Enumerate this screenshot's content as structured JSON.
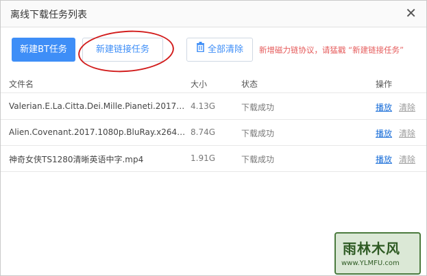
{
  "dialog": {
    "title": "离线下载任务列表",
    "close_glyph": "✕"
  },
  "toolbar": {
    "new_bt_label": "新建BT任务",
    "new_link_label": "新建链接任务",
    "clear_all_label": "全部清除",
    "hint_text": "新增磁力链协议，请猛戳 “新建链接任务”"
  },
  "table": {
    "headers": {
      "name": "文件名",
      "size": "大小",
      "status": "状态",
      "actions": "操作"
    },
    "rows": [
      {
        "name": "Valerian.E.La.Citta.Dei.Mille.Pianeti.2017.iTA...",
        "size": "4.13G",
        "status": "下载成功",
        "play": "播放",
        "clear": "清除"
      },
      {
        "name": "Alien.Covenant.2017.1080p.BluRay.x264-SP...",
        "size": "8.74G",
        "status": "下载成功",
        "play": "播放",
        "clear": "清除"
      },
      {
        "name": "神奇女侠TS1280清晰英语中字.mp4",
        "size": "1.91G",
        "status": "下载成功",
        "play": "播放",
        "clear": "清除"
      }
    ]
  },
  "watermark": {
    "main": "雨林木风",
    "url": "www.YLMFU.com"
  },
  "colors": {
    "primary": "#3e8ef7",
    "hint": "#e55a5a",
    "annotation": "#d21d1d"
  },
  "icons": {
    "close": "close-icon",
    "trash": "trash-icon"
  }
}
